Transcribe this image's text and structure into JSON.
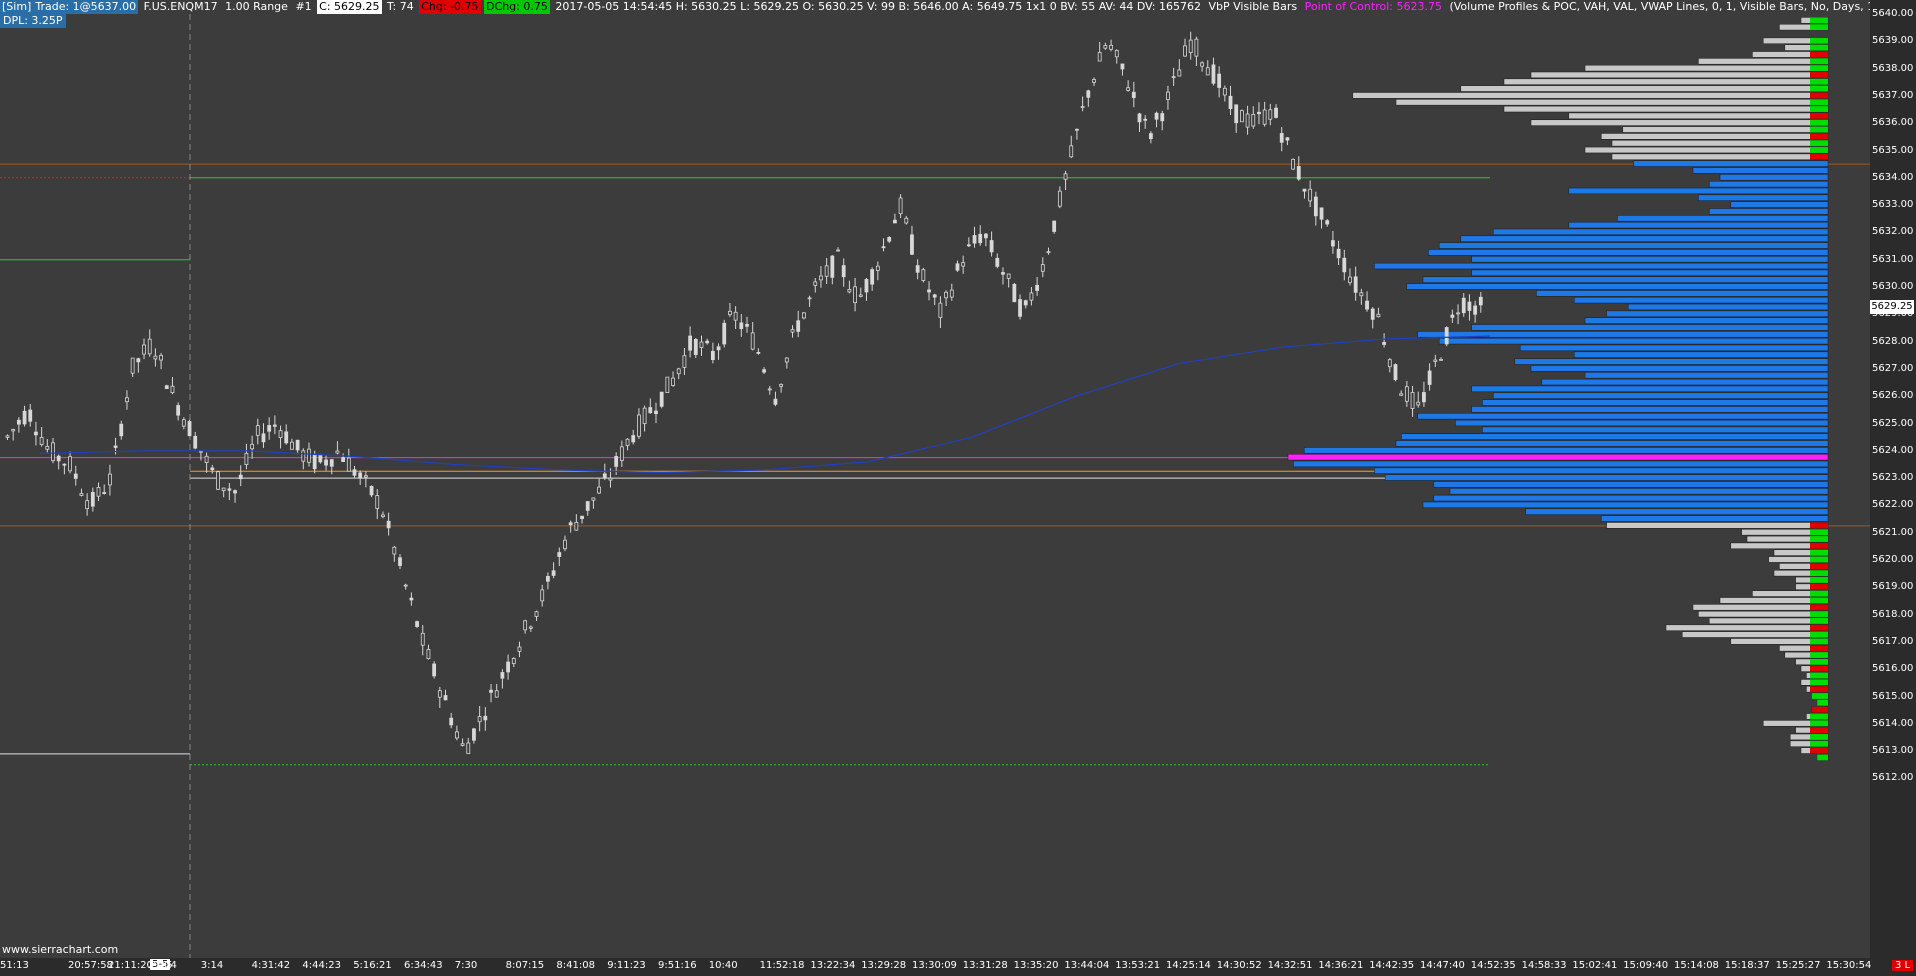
{
  "header": {
    "sim": "[Sim]",
    "trade": "Trade: 1@5637.00",
    "symbol": "F.US.ENQM17",
    "range": "1.00 Range",
    "chart_num": "#1",
    "close": "C: 5629.25",
    "ticks": "T: 74",
    "chg": "Chg: -0.75",
    "dchg": "DChg: 0.75",
    "stats": "2017-05-05 14:54:45 H: 5630.25 L: 5629.25 O: 5630.25 V: 99 B: 5646.00 A: 5649.75 1x1 0 BV: 55 AV: 44 DV: 165762",
    "study": "VbP Visible Bars",
    "poc": "Point of Control: 5623.75",
    "study_params": "(Volume Profiles & POC, VAH, VAL, VWAP Lines, 0, 1, Visible Bars, No, Days, 1, 50, 1000000, 0, , No, 00:00:00,"
  },
  "dpl": "DPL: 3.25P",
  "current_price": "5629.25",
  "watermark": "www.sierrachart.com",
  "last_badge": "3 L",
  "colors": {
    "background": "#3c3c3c",
    "candle": "#d8d8d8",
    "vwap": "#2040c0",
    "profile_value_area": "#1e78e6",
    "profile_outside": "#c8c8c8",
    "profile_ask": "#00dd00",
    "profile_bid": "#e00000",
    "poc": "#ff20ff"
  },
  "price_axis": {
    "labels": [
      "5640.00",
      "5639.00",
      "5638.00",
      "5637.00",
      "5636.00",
      "5635.00",
      "5634.00",
      "5633.00",
      "5632.00",
      "5631.00",
      "5630.00",
      "5629.00",
      "5628.00",
      "5627.00",
      "5626.00",
      "5625.00",
      "5624.00",
      "5623.00",
      "5622.00",
      "5621.00",
      "5620.00",
      "5619.00",
      "5618.00",
      "5617.00",
      "5616.00",
      "5615.00",
      "5614.00",
      "5613.00",
      "5612.00"
    ]
  },
  "time_axis": {
    "date_badge": "5-5",
    "labels": [
      "51:13",
      "20:57:58",
      "21:11:20",
      "23:04",
      "2:15",
      "3:14",
      "4:31:42",
      "4:44:23",
      "5:16:21",
      "6:34:43",
      "7:30",
      "8:07:15",
      "8:41:08",
      "9:11:23",
      "9:51:16",
      "10:40",
      "11:52:18",
      "13:22:34",
      "13:29:28",
      "13:30:09",
      "13:31:28",
      "13:35:20",
      "13:44:04",
      "13:53:21",
      "14:25:14",
      "14:30:52",
      "14:32:51",
      "14:36:21",
      "14:42:35",
      "14:47:40",
      "14:52:35",
      "14:58:33",
      "15:02:41",
      "15:09:40",
      "15:14:08",
      "15:18:37",
      "15:25:27",
      "15:30:54"
    ]
  },
  "chart_data": {
    "type": "candlestick",
    "session_highlight_lines": {
      "poc": 5623.75,
      "vah": 5634.0,
      "val": 5623.25,
      "prior_high": 5634.5,
      "prior_low": 5621.25
    },
    "close_path": [
      5624.5,
      5625.5,
      5624.0,
      5623.5,
      5622.0,
      5623.0,
      5627.0,
      5628.0,
      5626.0,
      5624.5,
      5623.0,
      5622.5,
      5624.5,
      5625.0,
      5624.0,
      5623.5,
      5624.0,
      5623.0,
      5622.0,
      5619.5,
      5617.0,
      5615.0,
      5613.0,
      5614.5,
      5616.0,
      5617.5,
      5619.0,
      5621.0,
      5622.0,
      5623.0,
      5624.5,
      5625.5,
      5626.5,
      5628.0,
      5627.5,
      5629.0,
      5628.0,
      5626.0,
      5628.5,
      5630.0,
      5631.0,
      5629.5,
      5631.0,
      5633.0,
      5630.5,
      5629.0,
      5631.0,
      5632.0,
      5630.5,
      5629.0,
      5631.0,
      5634.0,
      5637.0,
      5639.0,
      5637.5,
      5635.5,
      5637.0,
      5639.0,
      5638.0,
      5636.5,
      5636.0,
      5636.5,
      5634.5,
      5633.0,
      5631.5,
      5630.0,
      5629.0,
      5626.5,
      5625.5,
      5627.5,
      5629.5,
      5629.25
    ],
    "vwap": [
      5623.9,
      5624.0,
      5624.0,
      5623.8,
      5623.5,
      5623.3,
      5623.2,
      5623.3,
      5623.6,
      5624.5,
      5626.0,
      5627.2,
      5627.8,
      5628.1,
      5628.2
    ],
    "volume_profile": [
      {
        "price": 5639.75,
        "vol": 0.05,
        "va": false
      },
      {
        "price": 5639.5,
        "vol": 0.09,
        "va": false
      },
      {
        "price": 5639.0,
        "vol": 0.12,
        "va": false
      },
      {
        "price": 5638.75,
        "vol": 0.08,
        "va": false
      },
      {
        "price": 5638.5,
        "vol": 0.14,
        "va": false
      },
      {
        "price": 5638.25,
        "vol": 0.24,
        "va": false
      },
      {
        "price": 5638.0,
        "vol": 0.45,
        "va": false
      },
      {
        "price": 5637.75,
        "vol": 0.55,
        "va": false
      },
      {
        "price": 5637.5,
        "vol": 0.6,
        "va": false
      },
      {
        "price": 5637.25,
        "vol": 0.68,
        "va": false
      },
      {
        "price": 5637.0,
        "vol": 0.88,
        "va": false
      },
      {
        "price": 5636.75,
        "vol": 0.8,
        "va": false
      },
      {
        "price": 5636.5,
        "vol": 0.6,
        "va": false
      },
      {
        "price": 5636.25,
        "vol": 0.48,
        "va": false
      },
      {
        "price": 5636.0,
        "vol": 0.55,
        "va": false
      },
      {
        "price": 5635.75,
        "vol": 0.38,
        "va": false
      },
      {
        "price": 5635.5,
        "vol": 0.42,
        "va": false
      },
      {
        "price": 5635.25,
        "vol": 0.4,
        "va": false
      },
      {
        "price": 5635.0,
        "vol": 0.45,
        "va": false
      },
      {
        "price": 5634.75,
        "vol": 0.4,
        "va": false
      },
      {
        "price": 5634.5,
        "vol": 0.36,
        "va": true
      },
      {
        "price": 5634.25,
        "vol": 0.25,
        "va": true
      },
      {
        "price": 5634.0,
        "vol": 0.2,
        "va": true
      },
      {
        "price": 5633.75,
        "vol": 0.22,
        "va": true
      },
      {
        "price": 5633.5,
        "vol": 0.48,
        "va": true
      },
      {
        "price": 5633.25,
        "vol": 0.24,
        "va": true
      },
      {
        "price": 5633.0,
        "vol": 0.18,
        "va": true
      },
      {
        "price": 5632.75,
        "vol": 0.22,
        "va": true
      },
      {
        "price": 5632.5,
        "vol": 0.39,
        "va": true
      },
      {
        "price": 5632.25,
        "vol": 0.48,
        "va": true
      },
      {
        "price": 5632.0,
        "vol": 0.62,
        "va": true
      },
      {
        "price": 5631.75,
        "vol": 0.68,
        "va": true
      },
      {
        "price": 5631.5,
        "vol": 0.72,
        "va": true
      },
      {
        "price": 5631.25,
        "vol": 0.74,
        "va": true
      },
      {
        "price": 5631.0,
        "vol": 0.66,
        "va": true
      },
      {
        "price": 5630.75,
        "vol": 0.84,
        "va": true
      },
      {
        "price": 5630.5,
        "vol": 0.66,
        "va": true
      },
      {
        "price": 5630.25,
        "vol": 0.75,
        "va": true
      },
      {
        "price": 5630.0,
        "vol": 0.78,
        "va": true
      },
      {
        "price": 5629.75,
        "vol": 0.54,
        "va": true
      },
      {
        "price": 5629.5,
        "vol": 0.47,
        "va": true
      },
      {
        "price": 5629.25,
        "vol": 0.37,
        "va": true
      },
      {
        "price": 5629.0,
        "vol": 0.41,
        "va": true
      },
      {
        "price": 5628.75,
        "vol": 0.45,
        "va": true
      },
      {
        "price": 5628.5,
        "vol": 0.66,
        "va": true
      },
      {
        "price": 5628.25,
        "vol": 0.76,
        "va": true
      },
      {
        "price": 5628.0,
        "vol": 0.72,
        "va": true
      },
      {
        "price": 5627.75,
        "vol": 0.57,
        "va": true
      },
      {
        "price": 5627.5,
        "vol": 0.47,
        "va": true
      },
      {
        "price": 5627.25,
        "vol": 0.58,
        "va": true
      },
      {
        "price": 5627.0,
        "vol": 0.55,
        "va": true
      },
      {
        "price": 5626.75,
        "vol": 0.45,
        "va": true
      },
      {
        "price": 5626.5,
        "vol": 0.53,
        "va": true
      },
      {
        "price": 5626.25,
        "vol": 0.66,
        "va": true
      },
      {
        "price": 5626.0,
        "vol": 0.62,
        "va": true
      },
      {
        "price": 5625.75,
        "vol": 0.64,
        "va": true
      },
      {
        "price": 5625.5,
        "vol": 0.66,
        "va": true
      },
      {
        "price": 5625.25,
        "vol": 0.76,
        "va": true
      },
      {
        "price": 5625.0,
        "vol": 0.69,
        "va": true
      },
      {
        "price": 5624.75,
        "vol": 0.64,
        "va": true
      },
      {
        "price": 5624.5,
        "vol": 0.79,
        "va": true
      },
      {
        "price": 5624.25,
        "vol": 0.8,
        "va": true
      },
      {
        "price": 5624.0,
        "vol": 0.97,
        "va": true
      },
      {
        "price": 5623.75,
        "vol": 1.0,
        "va": true,
        "poc": true
      },
      {
        "price": 5623.5,
        "vol": 0.99,
        "va": true
      },
      {
        "price": 5623.25,
        "vol": 0.84,
        "va": true
      },
      {
        "price": 5623.0,
        "vol": 0.82,
        "va": true
      },
      {
        "price": 5622.75,
        "vol": 0.73,
        "va": true
      },
      {
        "price": 5622.5,
        "vol": 0.7,
        "va": true
      },
      {
        "price": 5622.25,
        "vol": 0.73,
        "va": true
      },
      {
        "price": 5622.0,
        "vol": 0.75,
        "va": true
      },
      {
        "price": 5621.75,
        "vol": 0.56,
        "va": true
      },
      {
        "price": 5621.5,
        "vol": 0.42,
        "va": true
      },
      {
        "price": 5621.25,
        "vol": 0.41,
        "va": false
      },
      {
        "price": 5621.0,
        "vol": 0.16,
        "va": false
      },
      {
        "price": 5620.75,
        "vol": 0.15,
        "va": false
      },
      {
        "price": 5620.5,
        "vol": 0.18,
        "va": false
      },
      {
        "price": 5620.25,
        "vol": 0.1,
        "va": false
      },
      {
        "price": 5620.0,
        "vol": 0.11,
        "va": false
      },
      {
        "price": 5619.75,
        "vol": 0.09,
        "va": false
      },
      {
        "price": 5619.5,
        "vol": 0.1,
        "va": false
      },
      {
        "price": 5619.25,
        "vol": 0.06,
        "va": false
      },
      {
        "price": 5619.0,
        "vol": 0.06,
        "va": false
      },
      {
        "price": 5618.75,
        "vol": 0.14,
        "va": false
      },
      {
        "price": 5618.5,
        "vol": 0.2,
        "va": false
      },
      {
        "price": 5618.25,
        "vol": 0.25,
        "va": false
      },
      {
        "price": 5618.0,
        "vol": 0.24,
        "va": false
      },
      {
        "price": 5617.75,
        "vol": 0.22,
        "va": false
      },
      {
        "price": 5617.5,
        "vol": 0.3,
        "va": false
      },
      {
        "price": 5617.25,
        "vol": 0.27,
        "va": false
      },
      {
        "price": 5617.0,
        "vol": 0.18,
        "va": false
      },
      {
        "price": 5616.75,
        "vol": 0.09,
        "va": false
      },
      {
        "price": 5616.5,
        "vol": 0.08,
        "va": false
      },
      {
        "price": 5616.25,
        "vol": 0.06,
        "va": false
      },
      {
        "price": 5616.0,
        "vol": 0.05,
        "va": false
      },
      {
        "price": 5615.75,
        "vol": 0.04,
        "va": false
      },
      {
        "price": 5615.5,
        "vol": 0.05,
        "va": false
      },
      {
        "price": 5615.25,
        "vol": 0.04,
        "va": false
      },
      {
        "price": 5615.0,
        "vol": 0.03,
        "va": false
      },
      {
        "price": 5614.75,
        "vol": 0.02,
        "va": false
      },
      {
        "price": 5614.5,
        "vol": 0.03,
        "va": false
      },
      {
        "price": 5614.25,
        "vol": 0.04,
        "va": false
      },
      {
        "price": 5614.0,
        "vol": 0.12,
        "va": false
      },
      {
        "price": 5613.75,
        "vol": 0.06,
        "va": false
      },
      {
        "price": 5613.5,
        "vol": 0.07,
        "va": false
      },
      {
        "price": 5613.25,
        "vol": 0.07,
        "va": false
      },
      {
        "price": 5613.0,
        "vol": 0.05,
        "va": false
      },
      {
        "price": 5612.75,
        "vol": 0.02,
        "va": false
      }
    ]
  }
}
